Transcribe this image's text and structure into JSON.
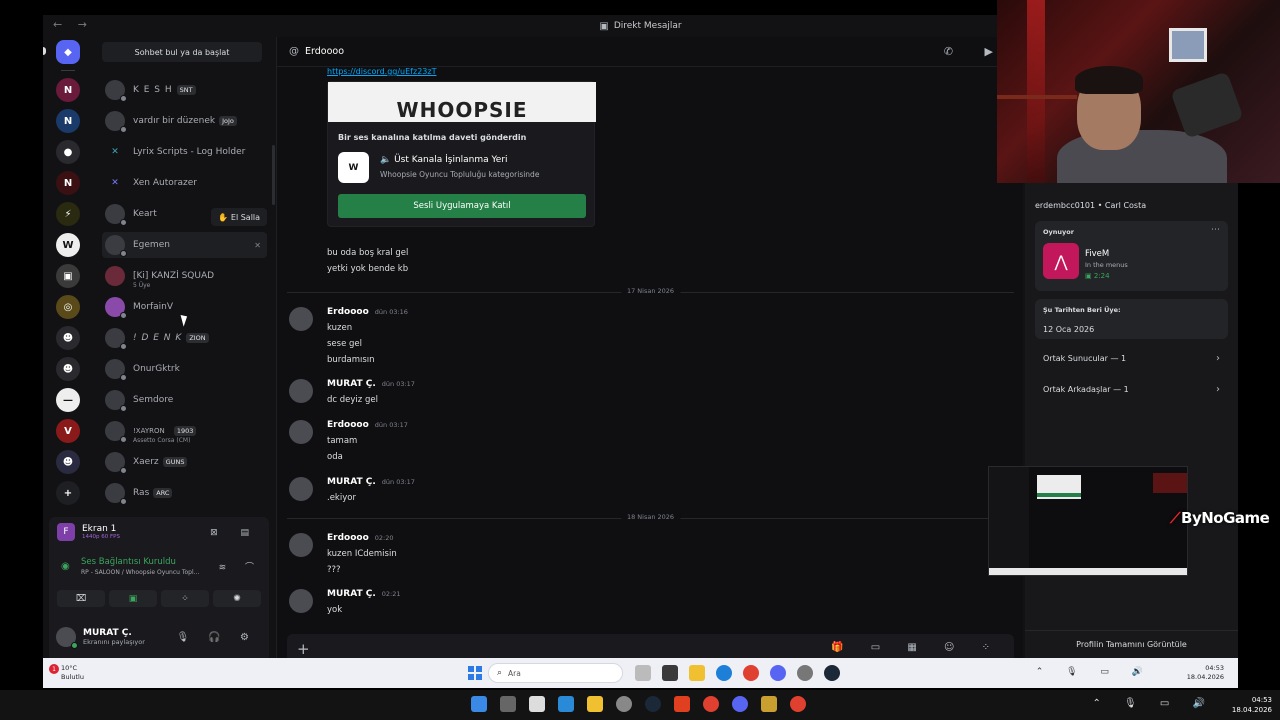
{
  "window": {
    "title": "Direkt Mesajlar"
  },
  "dm_sidebar": {
    "search_placeholder": "Sohbet bul ya da başlat",
    "items": [
      {
        "name": "K E S H",
        "tag": "SNT"
      },
      {
        "name": "vardır bir düzenek",
        "tag": "JoJo"
      },
      {
        "name": "Lyrix Scripts - Log Holder"
      },
      {
        "name": "Xen Autorazer"
      },
      {
        "name": "Keart",
        "action": "El Salla"
      },
      {
        "name": "Egemen"
      },
      {
        "name": "[Ki] KANZİ SQUAD",
        "sub": "5 Üye"
      },
      {
        "name": "MorfainV"
      },
      {
        "name": "! D E N K",
        "tag": "ZION"
      },
      {
        "name": "OnurGktrk"
      },
      {
        "name": "Semdore"
      },
      {
        "name": "!XAYRON",
        "tag": "1903",
        "sub": "Assetto Corsa (CM)"
      },
      {
        "name": "Xaerz",
        "tag": "GUNS"
      },
      {
        "name": "Ras",
        "tag": "ARC"
      }
    ]
  },
  "screen_share": {
    "title": "Ekran 1",
    "quality": "1440p 60 FPS"
  },
  "voice": {
    "status": "Ses Bağlantısı Kuruldu",
    "channel": "RP - SALOON / Whoopsie Oyuncu Topl..."
  },
  "user": {
    "name": "MURAT Ç.",
    "status": "Ekranını paylaşıyor"
  },
  "chat": {
    "recipient": "Erdoooo",
    "link": "https://discord.gg/uEfz23zT",
    "invite": {
      "banner": "WHOOPSIE",
      "heading": "Bir ses kanalına katılma daveti gönderdin",
      "logo": "W",
      "channel": "Üst Kanala İşinlanma Yeri",
      "category": "Whoopsie Oyuncu Topluluğu kategorisinde",
      "button": "Sesli Uygulamaya Katıl"
    },
    "lines_before": [
      "bu oda boş kral gel",
      "yetki  yok bende kb"
    ],
    "date1": "17 Nisan 2026",
    "date2": "18 Nisan 2026",
    "messages": [
      {
        "author": "Erdoooo",
        "time": "dün 03:16",
        "lines": [
          "kuzen",
          "sese gel",
          "burdamısın"
        ]
      },
      {
        "author": "MURAT Ç.",
        "time": "dün 03:17",
        "lines": [
          "dc deyiz gel"
        ]
      },
      {
        "author": "Erdoooo",
        "time": "dün 03:17",
        "lines": [
          "tamam",
          "oda"
        ]
      },
      {
        "author": "MURAT Ç.",
        "time": "dün 03:17",
        "lines": [
          ".ekiyor"
        ]
      },
      {
        "author": "Erdoooo",
        "time": "02:20",
        "lines": [
          "kuzen ICdemisin",
          "???"
        ]
      },
      {
        "author": "MURAT Ç.",
        "time": "02:21",
        "lines": [
          "yok"
        ]
      }
    ]
  },
  "profile": {
    "username_line": "erdembcc0101 • Carl Costa",
    "playing_label": "Oynuyor",
    "game": "FiveM",
    "game_state": "In the menus",
    "game_time": "2:24",
    "member_since_label": "Şu Tarihten Beri Üye:",
    "member_since": "12 Oca 2026",
    "mutual_servers": "Ortak Sunucular — 1",
    "mutual_friends": "Ortak Arkadaşlar — 1",
    "full_profile": "Profilin Tamamını Görüntüle"
  },
  "brand": "ByNoGame",
  "inner_taskbar": {
    "temp": "10°C",
    "weather": "Bulutlu",
    "search": "Ara",
    "time": "04:53",
    "date": "18.04.2026"
  },
  "outer_taskbar": {
    "time": "04:53",
    "date": "18.04.2026"
  },
  "colors": {
    "accent_green": "#248046",
    "online": "#3ba55d",
    "link": "#00a8fc",
    "brand_red": "#e0262d"
  }
}
